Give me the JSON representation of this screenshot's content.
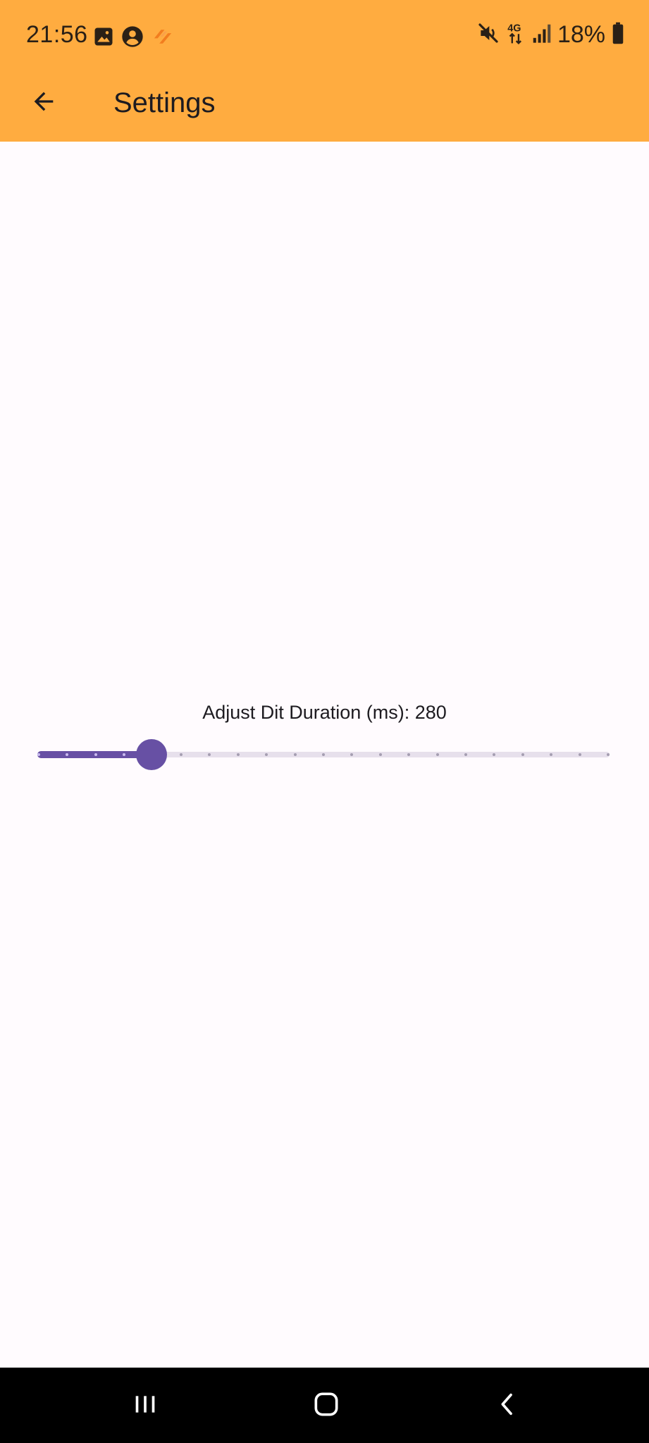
{
  "status_bar": {
    "time": "21:56",
    "battery": "18%",
    "left_icons": [
      "image-icon",
      "account-circle-icon",
      "app-notification-icon"
    ],
    "right_icons": [
      "mute-icon",
      "network-4g-icon",
      "signal-icon",
      "battery-icon"
    ]
  },
  "app_bar": {
    "title": "Settings",
    "back_icon": "arrow-back-icon",
    "background": "#ffac40"
  },
  "settings": {
    "slider_label": "Adjust Dit Duration (ms): 280",
    "slider": {
      "divisions": 20,
      "position_fraction": 0.2,
      "active_color": "#6750a4",
      "inactive_color": "#e7e0ec"
    }
  },
  "nav_bar": {
    "buttons": [
      "recent-apps-icon",
      "home-icon",
      "back-icon"
    ]
  }
}
